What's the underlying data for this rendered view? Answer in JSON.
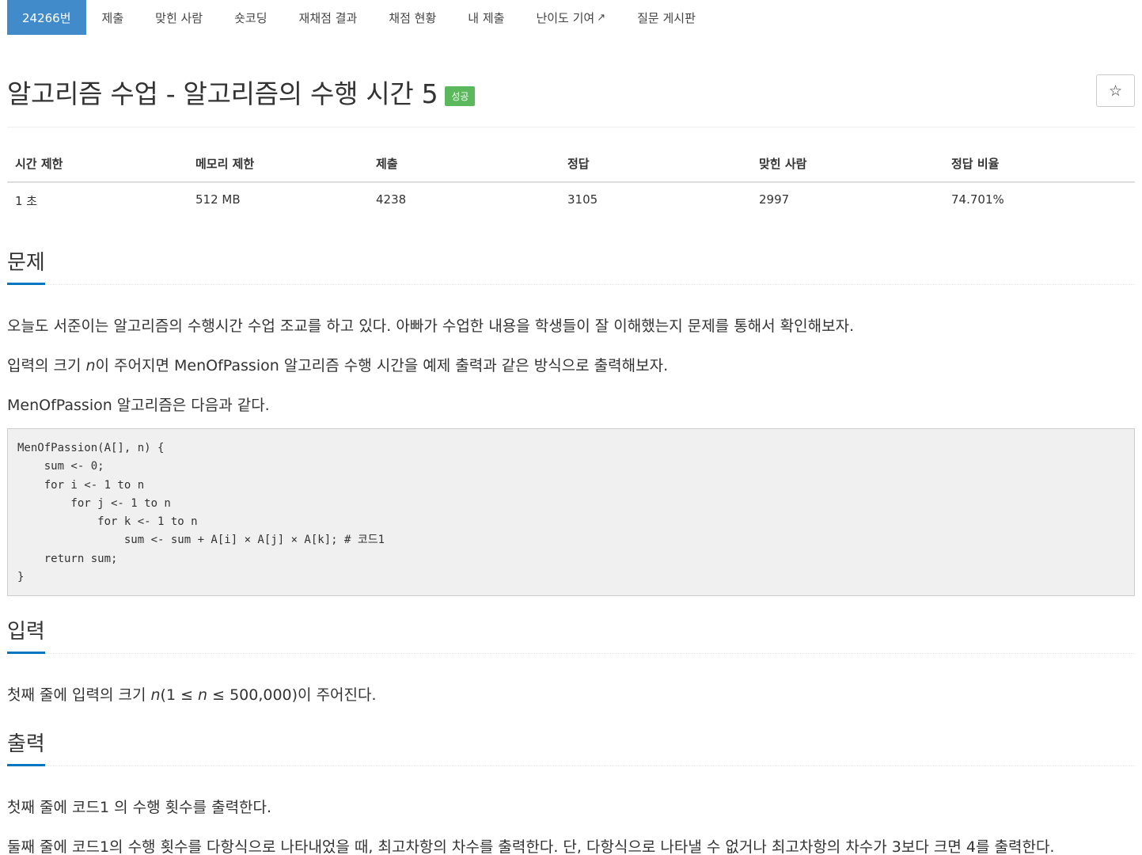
{
  "nav": {
    "items": [
      {
        "label": "24266번",
        "active": true
      },
      {
        "label": "제출"
      },
      {
        "label": "맞힌 사람"
      },
      {
        "label": "숏코딩"
      },
      {
        "label": "재채점 결과"
      },
      {
        "label": "채점 현황"
      },
      {
        "label": "내 제출"
      },
      {
        "label": "난이도 기여",
        "icon": "external-link-icon"
      },
      {
        "label": "질문 게시판"
      }
    ]
  },
  "problem": {
    "title": "알고리즘 수업 - 알고리즘의 수행 시간 5",
    "badge": "성공",
    "star_icon": "☆"
  },
  "info_table": {
    "headers": [
      "시간 제한",
      "메모리 제한",
      "제출",
      "정답",
      "맞힌 사람",
      "정답 비율"
    ],
    "values": [
      "1 초",
      "512 MB",
      "4238",
      "3105",
      "2997",
      "74.701%"
    ]
  },
  "sections": {
    "problem": {
      "heading": "문제",
      "p1": "오늘도 서준이는 알고리즘의 수행시간 수업 조교를 하고 있다. 아빠가 수업한 내용을 학생들이 잘 이해했는지 문제를 통해서 확인해보자.",
      "p2_before": "입력의 크기 ",
      "p2_var": "n",
      "p2_after": "이 주어지면 MenOfPassion 알고리즘 수행 시간을 예제 출력과 같은 방식으로 출력해보자.",
      "p3": "MenOfPassion 알고리즘은 다음과 같다.",
      "code": "MenOfPassion(A[], n) {\n    sum <- 0;\n    for i <- 1 to n\n        for j <- 1 to n\n            for k <- 1 to n\n                sum <- sum + A[i] × A[j] × A[k]; # 코드1\n    return sum;\n}"
    },
    "input": {
      "heading": "입력",
      "p_before": "첫째 줄에 입력의 크기 ",
      "p_var1": "n",
      "p_mid1": "(1 ≤ ",
      "p_var2": "n",
      "p_mid2": " ≤ 500,000)이 주어진다."
    },
    "output": {
      "heading": "출력",
      "p1": "첫째 줄에 코드1 의 수행 횟수를 출력한다.",
      "p2": "둘째 줄에 코드1의 수행 횟수를 다항식으로 나타내었을 때, 최고차항의 차수를 출력한다. 단, 다항식으로 나타낼 수 없거나 최고차항의 차수가 3보다 크면 4를 출력한다."
    }
  },
  "colors": {
    "nav_active": "#428bca",
    "badge": "#5cb85c",
    "headline_underline": "#0076c0"
  }
}
